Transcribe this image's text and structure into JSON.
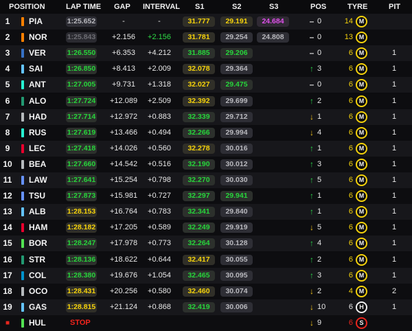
{
  "header": {
    "position": "POSITION",
    "lap_time": "LAP TIME",
    "gap": "GAP",
    "interval": "INTERVAL",
    "s1": "S1",
    "s2": "S2",
    "s3": "S3",
    "pos": "POS",
    "tyre": "TYRE",
    "pit": "PIT"
  },
  "colors": {
    "green": "#27d43b",
    "yellow": "#f5d20b",
    "purple": "#e050ec",
    "red": "#f2241c"
  },
  "rows": [
    {
      "pos": "1",
      "team_color": "#ff8000",
      "code": "PIA",
      "lap": "1:25.652",
      "lap_style": "grey",
      "gap": "-",
      "interval": "-",
      "interval_style": "white",
      "s1": "31.777",
      "s1_style": "yellow",
      "s2": "29.191",
      "s2_style": "yellow",
      "s3": "24.684",
      "s3_style": "purple",
      "arrow": "same",
      "arrow_glyph": "–",
      "change": "0",
      "laps": "14",
      "laps_color": "#f5d20b",
      "tyre": "M",
      "tyre_type": "medium",
      "pit": ""
    },
    {
      "pos": "2",
      "team_color": "#ff8000",
      "code": "NOR",
      "lap": "1:25.843",
      "lap_style": "dim",
      "gap": "+2.156",
      "interval": "+2.156",
      "interval_style": "green",
      "s1": "31.781",
      "s1_style": "yellow",
      "s2": "29.254",
      "s2_style": "grey",
      "s3": "24.808",
      "s3_style": "grey",
      "arrow": "same",
      "arrow_glyph": "–",
      "change": "0",
      "laps": "13",
      "laps_color": "#f5d20b",
      "tyre": "M",
      "tyre_type": "medium",
      "pit": ""
    },
    {
      "pos": "3",
      "team_color": "#3671c6",
      "code": "VER",
      "lap": "1:26.550",
      "lap_style": "green",
      "gap": "+6.353",
      "interval": "+4.212",
      "interval_style": "white",
      "s1": "31.885",
      "s1_style": "green",
      "s2": "29.206",
      "s2_style": "green",
      "s3": "",
      "s3_style": "",
      "arrow": "same",
      "arrow_glyph": "–",
      "change": "0",
      "laps": "6",
      "laps_color": "#f5d20b",
      "tyre": "M",
      "tyre_type": "medium",
      "pit": "1"
    },
    {
      "pos": "4",
      "team_color": "#64c4ff",
      "code": "SAI",
      "lap": "1:26.850",
      "lap_style": "green",
      "gap": "+8.413",
      "interval": "+2.009",
      "interval_style": "white",
      "s1": "32.078",
      "s1_style": "yellow",
      "s2": "29.364",
      "s2_style": "grey",
      "s3": "",
      "s3_style": "",
      "arrow": "up",
      "arrow_glyph": "↑",
      "change": "3",
      "laps": "6",
      "laps_color": "#f5d20b",
      "tyre": "M",
      "tyre_type": "medium",
      "pit": "1"
    },
    {
      "pos": "5",
      "team_color": "#27f4d2",
      "code": "ANT",
      "lap": "1:27.005",
      "lap_style": "green",
      "gap": "+9.731",
      "interval": "+1.318",
      "interval_style": "white",
      "s1": "32.027",
      "s1_style": "yellow",
      "s2": "29.475",
      "s2_style": "green",
      "s3": "",
      "s3_style": "",
      "arrow": "same",
      "arrow_glyph": "–",
      "change": "0",
      "laps": "6",
      "laps_color": "#f5d20b",
      "tyre": "M",
      "tyre_type": "medium",
      "pit": "1"
    },
    {
      "pos": "6",
      "team_color": "#229971",
      "code": "ALO",
      "lap": "1:27.724",
      "lap_style": "green",
      "gap": "+12.089",
      "interval": "+2.509",
      "interval_style": "white",
      "s1": "32.392",
      "s1_style": "yellow",
      "s2": "29.699",
      "s2_style": "grey",
      "s3": "",
      "s3_style": "",
      "arrow": "up",
      "arrow_glyph": "↑",
      "change": "2",
      "laps": "6",
      "laps_color": "#f5d20b",
      "tyre": "M",
      "tyre_type": "medium",
      "pit": "1"
    },
    {
      "pos": "7",
      "team_color": "#b6babd",
      "code": "HAD",
      "lap": "1:27.714",
      "lap_style": "green",
      "gap": "+12.972",
      "interval": "+0.883",
      "interval_style": "white",
      "s1": "32.339",
      "s1_style": "green",
      "s2": "29.712",
      "s2_style": "grey",
      "s3": "",
      "s3_style": "",
      "arrow": "down",
      "arrow_glyph": "↓",
      "change": "1",
      "laps": "6",
      "laps_color": "#f5d20b",
      "tyre": "M",
      "tyre_type": "medium",
      "pit": "1"
    },
    {
      "pos": "8",
      "team_color": "#27f4d2",
      "code": "RUS",
      "lap": "1:27.619",
      "lap_style": "green",
      "gap": "+13.466",
      "interval": "+0.494",
      "interval_style": "white",
      "s1": "32.266",
      "s1_style": "green",
      "s2": "29.994",
      "s2_style": "grey",
      "s3": "",
      "s3_style": "",
      "arrow": "down",
      "arrow_glyph": "↓",
      "change": "4",
      "laps": "6",
      "laps_color": "#f5d20b",
      "tyre": "M",
      "tyre_type": "medium",
      "pit": "1"
    },
    {
      "pos": "9",
      "team_color": "#e8002d",
      "code": "LEC",
      "lap": "1:27.418",
      "lap_style": "green",
      "gap": "+14.026",
      "interval": "+0.560",
      "interval_style": "white",
      "s1": "32.278",
      "s1_style": "yellow",
      "s2": "30.016",
      "s2_style": "grey",
      "s3": "",
      "s3_style": "",
      "arrow": "up",
      "arrow_glyph": "↑",
      "change": "1",
      "laps": "6",
      "laps_color": "#f5d20b",
      "tyre": "M",
      "tyre_type": "medium",
      "pit": "1"
    },
    {
      "pos": "10",
      "team_color": "#b6babd",
      "code": "BEA",
      "lap": "1:27.660",
      "lap_style": "green",
      "gap": "+14.542",
      "interval": "+0.516",
      "interval_style": "white",
      "s1": "32.190",
      "s1_style": "green",
      "s2": "30.012",
      "s2_style": "grey",
      "s3": "",
      "s3_style": "",
      "arrow": "up",
      "arrow_glyph": "↑",
      "change": "3",
      "laps": "6",
      "laps_color": "#f5d20b",
      "tyre": "M",
      "tyre_type": "medium",
      "pit": "1"
    },
    {
      "pos": "11",
      "team_color": "#6692ff",
      "code": "LAW",
      "lap": "1:27.641",
      "lap_style": "green",
      "gap": "+15.254",
      "interval": "+0.798",
      "interval_style": "white",
      "s1": "32.270",
      "s1_style": "green",
      "s2": "30.030",
      "s2_style": "grey",
      "s3": "",
      "s3_style": "",
      "arrow": "up",
      "arrow_glyph": "↑",
      "change": "5",
      "laps": "6",
      "laps_color": "#f5d20b",
      "tyre": "M",
      "tyre_type": "medium",
      "pit": "1"
    },
    {
      "pos": "12",
      "team_color": "#6692ff",
      "code": "TSU",
      "lap": "1:27.873",
      "lap_style": "green",
      "gap": "+15.981",
      "interval": "+0.727",
      "interval_style": "white",
      "s1": "32.297",
      "s1_style": "green",
      "s2": "29.941",
      "s2_style": "green",
      "s3": "",
      "s3_style": "",
      "arrow": "up",
      "arrow_glyph": "↑",
      "change": "1",
      "laps": "6",
      "laps_color": "#f5d20b",
      "tyre": "M",
      "tyre_type": "medium",
      "pit": "1"
    },
    {
      "pos": "13",
      "team_color": "#64c4ff",
      "code": "ALB",
      "lap": "1:28.153",
      "lap_style": "yellow",
      "gap": "+16.764",
      "interval": "+0.783",
      "interval_style": "white",
      "s1": "32.341",
      "s1_style": "green",
      "s2": "29.840",
      "s2_style": "grey",
      "s3": "",
      "s3_style": "",
      "arrow": "up",
      "arrow_glyph": "↑",
      "change": "1",
      "laps": "6",
      "laps_color": "#f5d20b",
      "tyre": "M",
      "tyre_type": "medium",
      "pit": "1"
    },
    {
      "pos": "14",
      "team_color": "#e8002d",
      "code": "HAM",
      "lap": "1:28.182",
      "lap_style": "yellow",
      "gap": "+17.205",
      "interval": "+0.589",
      "interval_style": "white",
      "s1": "32.249",
      "s1_style": "green",
      "s2": "29.919",
      "s2_style": "grey",
      "s3": "",
      "s3_style": "",
      "arrow": "down",
      "arrow_glyph": "↓",
      "change": "5",
      "laps": "6",
      "laps_color": "#f5d20b",
      "tyre": "M",
      "tyre_type": "medium",
      "pit": "1"
    },
    {
      "pos": "15",
      "team_color": "#52e252",
      "code": "BOR",
      "lap": "1:28.247",
      "lap_style": "green",
      "gap": "+17.978",
      "interval": "+0.773",
      "interval_style": "white",
      "s1": "32.264",
      "s1_style": "green",
      "s2": "30.128",
      "s2_style": "grey",
      "s3": "",
      "s3_style": "",
      "arrow": "up",
      "arrow_glyph": "↑",
      "change": "4",
      "laps": "6",
      "laps_color": "#f5d20b",
      "tyre": "M",
      "tyre_type": "medium",
      "pit": "1"
    },
    {
      "pos": "16",
      "team_color": "#229971",
      "code": "STR",
      "lap": "1:28.136",
      "lap_style": "green",
      "gap": "+18.622",
      "interval": "+0.644",
      "interval_style": "white",
      "s1": "32.417",
      "s1_style": "yellow",
      "s2": "30.055",
      "s2_style": "grey",
      "s3": "",
      "s3_style": "",
      "arrow": "up",
      "arrow_glyph": "↑",
      "change": "2",
      "laps": "6",
      "laps_color": "#f5d20b",
      "tyre": "M",
      "tyre_type": "medium",
      "pit": "1"
    },
    {
      "pos": "17",
      "team_color": "#0093cc",
      "code": "COL",
      "lap": "1:28.380",
      "lap_style": "green",
      "gap": "+19.676",
      "interval": "+1.054",
      "interval_style": "white",
      "s1": "32.465",
      "s1_style": "green",
      "s2": "30.095",
      "s2_style": "grey",
      "s3": "",
      "s3_style": "",
      "arrow": "up",
      "arrow_glyph": "↑",
      "change": "3",
      "laps": "6",
      "laps_color": "#f5d20b",
      "tyre": "M",
      "tyre_type": "medium",
      "pit": "1"
    },
    {
      "pos": "18",
      "team_color": "#b6babd",
      "code": "OCO",
      "lap": "1:28.431",
      "lap_style": "yellow",
      "gap": "+20.256",
      "interval": "+0.580",
      "interval_style": "white",
      "s1": "32.460",
      "s1_style": "yellow",
      "s2": "30.074",
      "s2_style": "grey",
      "s3": "",
      "s3_style": "",
      "arrow": "down",
      "arrow_glyph": "↓",
      "change": "2",
      "laps": "4",
      "laps_color": "#f5d20b",
      "tyre": "M",
      "tyre_type": "medium",
      "pit": "2"
    },
    {
      "pos": "19",
      "team_color": "#64c4ff",
      "code": "GAS",
      "lap": "1:28.815",
      "lap_style": "yellow",
      "gap": "+21.124",
      "interval": "+0.868",
      "interval_style": "white",
      "s1": "32.419",
      "s1_style": "green",
      "s2": "30.006",
      "s2_style": "grey",
      "s3": "",
      "s3_style": "",
      "arrow": "down",
      "arrow_glyph": "↓",
      "change": "10",
      "laps": "6",
      "laps_color": "#e8e8e8",
      "tyre": "H",
      "tyre_type": "hard",
      "pit": "1"
    },
    {
      "pos": "■",
      "pos_color": "#e7261e",
      "team_color": "#52e252",
      "code": "HUL",
      "lap": "STOP",
      "lap_style": "stop",
      "gap": "",
      "interval": "",
      "interval_style": "white",
      "s1": "",
      "s1_style": "",
      "s2": "",
      "s2_style": "",
      "s3": "",
      "s3_style": "",
      "arrow": "down",
      "arrow_glyph": "↓",
      "change": "9",
      "laps": "6",
      "laps_color": "#e7261e",
      "tyre": "S",
      "tyre_type": "soft",
      "pit": ""
    }
  ]
}
